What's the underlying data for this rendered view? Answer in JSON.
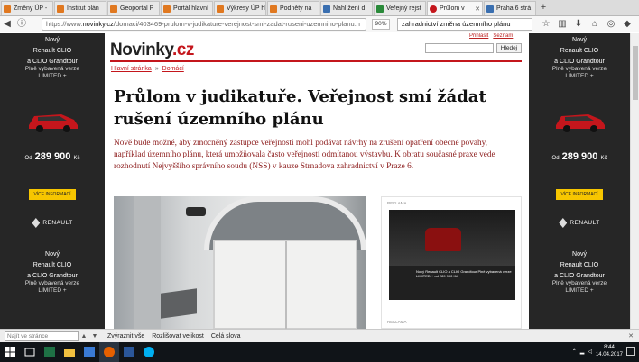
{
  "browser": {
    "tabs": [
      {
        "label": "Změny ÚP -",
        "color": "#e07820"
      },
      {
        "label": "Institut plán",
        "color": "#e07820"
      },
      {
        "label": "Geoportal P",
        "color": "#e07820"
      },
      {
        "label": "Portál hlavní",
        "color": "#e07820"
      },
      {
        "label": "Výkresy ÚP hl",
        "color": "#e07820"
      },
      {
        "label": "Podněty na",
        "color": "#e07820"
      },
      {
        "label": "Nahlížení d",
        "color": "#3a6fb0"
      },
      {
        "label": "Veřejný rejst",
        "color": "#2a8a3a"
      },
      {
        "label": "Průlom v",
        "color": "#c4161c"
      },
      {
        "label": "Praha 6 strá",
        "color": "#3a6fb0"
      }
    ],
    "new_tab": "+",
    "url_prefix": "https://www.",
    "url_host": "novinky.cz",
    "url_path": "/domaci/403469-prulom-v-judikature-verejnost-smi-zadat-ruseni-uzemniho-planu.h",
    "zoom": "90%",
    "search_text": "ahradnictví změna územního plánu",
    "search_prefix": "z"
  },
  "page": {
    "logo_main": "Novinky",
    "logo_suffix": ".cz",
    "toplinks": [
      "Přihlásit",
      "Seznam"
    ],
    "search_button": "Hledej",
    "breadcrumb": [
      "Hlavní stránka",
      "Domácí"
    ],
    "breadcrumb_sep": "»",
    "title": "Průlom v judikatuře. Veřejnost smí žádat rušení územního plánu",
    "perex": "Nově bude možné, aby zmocněný zástupce veřejnosti mohl podávat návrhy na zrušení opatření obecné povahy, například územního plánu, která umožňovala často veřejností odmítanou výstavbu. K obratu současné praxe vede rozhodnutí Nejvyššího správního soudu (NSS) v kauze Strnadova zahradnictví v Praze 6.",
    "photo_plaque": "",
    "ad_label": "REKLAMA",
    "ad_label2": "REKLAMA",
    "ad_inner_text": "Nový Renault CLIO a CLIO Grandtour Plně vybavená verze LIMITED + od 289 900 Kč"
  },
  "side_ad": {
    "t1": "Nový",
    "t2": "Renault CLIO",
    "t3": "a CLIO Grandtour",
    "t4": "Plně vybavená verze",
    "t5": "LIMITED +",
    "price_prefix": "Od",
    "price": "289 900",
    "price_unit": "Kč",
    "button": "VÍCE INFORMACÍ",
    "brand": "RENAULT",
    "brand_sub": "Passion for life"
  },
  "findbar": {
    "placeholder": "Najít ve stránce",
    "highlight_all": "Zvýraznit vše",
    "match_case": "Rozlišovat velikost",
    "whole_words": "Celá slova"
  },
  "taskbar": {
    "time": "8:44",
    "date": "14.04.2017"
  }
}
